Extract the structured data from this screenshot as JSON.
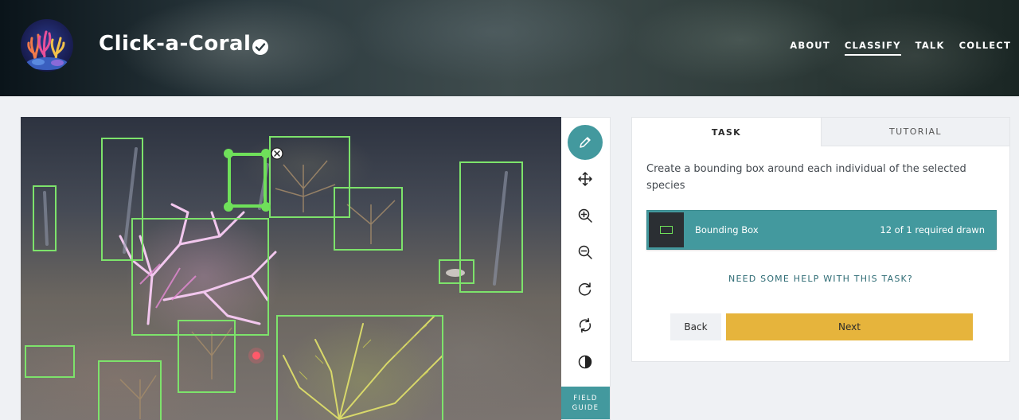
{
  "header": {
    "title": "Click-a-Coral",
    "verified_icon": "check-circle-icon",
    "nav": [
      {
        "label": "ABOUT",
        "active": false
      },
      {
        "label": "CLASSIFY",
        "active": true
      },
      {
        "label": "TALK",
        "active": false
      },
      {
        "label": "COLLECT",
        "active": false
      }
    ]
  },
  "toolbar": {
    "tools": [
      "pencil-icon",
      "move-icon",
      "zoom-in-icon",
      "zoom-out-icon",
      "rotate-icon",
      "reset-icon",
      "invert-icon"
    ],
    "active_tool": "pencil-icon",
    "field_guide_line1": "FIELD",
    "field_guide_line2": "GUIDE"
  },
  "task_panel": {
    "tabs": {
      "task": "TASK",
      "tutorial": "TUTORIAL"
    },
    "active_tab": "TASK",
    "instruction": "Create a bounding box around each individual of the selected species",
    "answer": {
      "label": "Bounding Box",
      "count_text": "12 of 1 required drawn",
      "icon": "rectangle-icon",
      "color": "#43999e"
    },
    "help_link": "NEED SOME HELP WITH THIS TASK?",
    "back_label": "Back",
    "next_label": "Next"
  },
  "colors": {
    "accent": "#43999e",
    "next_button": "#e6b43c",
    "annotation": "#7de36b"
  }
}
